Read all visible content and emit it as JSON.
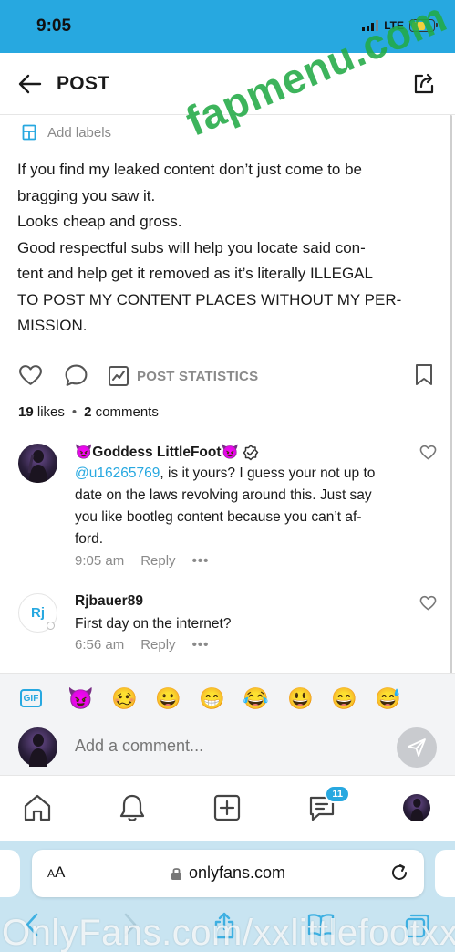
{
  "status_bar": {
    "time": "9:05",
    "network": "LTE",
    "battery_level": 0.65
  },
  "header": {
    "title": "POST",
    "back_icon": "back-arrow-icon",
    "share_icon": "share-icon"
  },
  "watermark": "fapmenu.com",
  "labels": {
    "text": "Add labels",
    "icon": "label-icon"
  },
  "post": {
    "lines": [
      "If you find my leaked content don’t just come to be",
      "bragging you saw it.",
      "Looks cheap and gross.",
      "Good respectful subs will help you locate said con-",
      "tent and help get it removed as it’s literally ILLEGAL",
      "TO POST MY CONTENT PLACES WITHOUT MY PER-",
      "MISSION."
    ]
  },
  "actions": {
    "stats_label": "POST STATISTICS"
  },
  "counts": {
    "likes_count": "19",
    "likes_label": "likes",
    "comments_count": "2",
    "comments_label": "comments"
  },
  "comments": [
    {
      "author": "😈Goddess LittleFoot😈",
      "mention": "@u16265769",
      "lines": [
        ", is it yours? I guess your not up to",
        "date on the laws revolving around this. Just say",
        "you like bootleg content because you can’t af-",
        "ford."
      ],
      "time": "9:05 am",
      "reply": "Reply",
      "more": "•••"
    },
    {
      "author": "Rjbauer89",
      "avatar_initials": "Rj",
      "text": "First day on the internet?",
      "time": "6:56 am",
      "reply": "Reply",
      "more": "•••"
    }
  ],
  "emoji_bar": {
    "gif_label": "GIF",
    "emojis": [
      "😈",
      "🥴",
      "😀",
      "😁",
      "😂",
      "😃",
      "😄",
      "😅"
    ]
  },
  "comment_box": {
    "placeholder": "Add a comment..."
  },
  "bottom_nav": {
    "messages_badge": "11"
  },
  "browser": {
    "aa_small": "A",
    "aa_large": "A",
    "url": "onlyfans.com"
  },
  "footer_watermark": "OnlyFans.com/xxlittlefootxx",
  "colors": {
    "accent": "#27a8e0",
    "watermark": "#22aa46",
    "muted": "#8a8a8a"
  }
}
